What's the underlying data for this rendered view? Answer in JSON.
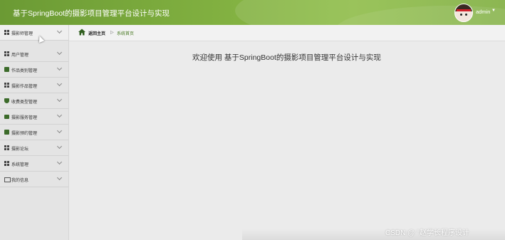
{
  "header": {
    "title": "基于SpringBoot的摄影项目管理平台设计与实现",
    "user_name": "admin"
  },
  "sidebar": {
    "items": [
      {
        "label": "摄影师管理",
        "icon": "grid-icon"
      },
      {
        "label": "用户管理",
        "icon": "grid-icon"
      },
      {
        "label": "作品类别管理",
        "icon": "book-icon"
      },
      {
        "label": "摄影作品管理",
        "icon": "grid-icon"
      },
      {
        "label": "收费类型管理",
        "icon": "shield-icon"
      },
      {
        "label": "摄影服务管理",
        "icon": "briefcase-icon"
      },
      {
        "label": "摄影预约管理",
        "icon": "book-icon"
      },
      {
        "label": "摄影论坛",
        "icon": "grid-icon"
      },
      {
        "label": "系统管理",
        "icon": "grid-icon"
      },
      {
        "label": "我的信息",
        "icon": "card-icon"
      }
    ]
  },
  "breadcrumb": {
    "home": "返回主页",
    "current": "系统首页"
  },
  "main": {
    "welcome": "欢迎使用 基于SpringBoot的摄影项目管理平台设计与实现"
  },
  "watermark": "CSDN @ °赵学长程序设计",
  "colors": {
    "header_green": "#7dac3e",
    "accent_green": "#4a7a24"
  }
}
